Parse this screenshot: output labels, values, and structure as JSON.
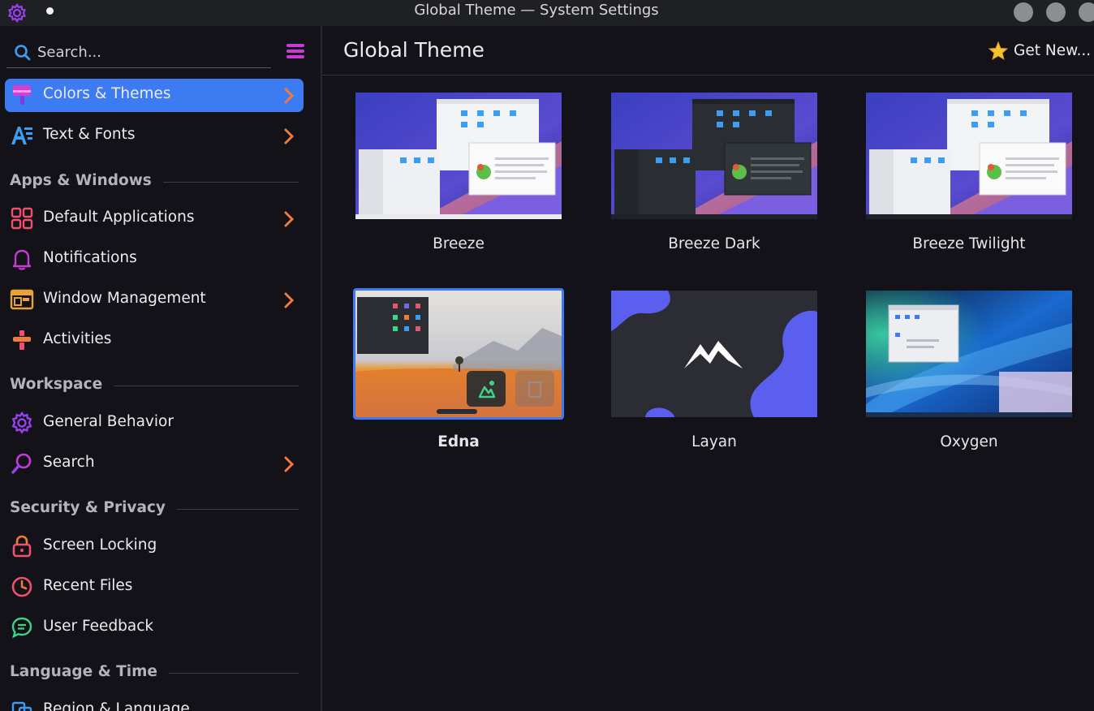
{
  "window": {
    "title": "Global Theme — System Settings"
  },
  "sidebar": {
    "search_placeholder": "Search...",
    "items": [
      {
        "label": "Colors & Themes",
        "active": true,
        "chevron": true
      },
      {
        "label": "Text & Fonts",
        "chevron": true
      },
      {
        "label": "Default Applications",
        "chevron": true
      },
      {
        "label": "Notifications",
        "chevron": false
      },
      {
        "label": "Window Management",
        "chevron": true
      },
      {
        "label": "Activities",
        "chevron": false
      },
      {
        "label": "General Behavior",
        "chevron": false
      },
      {
        "label": "Search",
        "chevron": true
      },
      {
        "label": "Screen Locking",
        "chevron": false
      },
      {
        "label": "Recent Files",
        "chevron": false
      },
      {
        "label": "User Feedback",
        "chevron": false
      },
      {
        "label": "Region & Language",
        "chevron": false
      }
    ],
    "sections": [
      {
        "label": "Apps & Windows"
      },
      {
        "label": "Workspace"
      },
      {
        "label": "Security & Privacy"
      },
      {
        "label": "Language & Time"
      }
    ]
  },
  "main": {
    "title": "Global Theme",
    "get_new_label": "Get New...",
    "themes": [
      {
        "name": "Breeze",
        "selected": false
      },
      {
        "name": "Breeze Dark",
        "selected": false
      },
      {
        "name": "Breeze Twilight",
        "selected": false
      },
      {
        "name": "Edna",
        "selected": true
      },
      {
        "name": "Layan",
        "selected": false
      },
      {
        "name": "Oxygen",
        "selected": false
      }
    ]
  },
  "colors": {
    "accent": "#3c7bf2",
    "background": "#121218",
    "titlebar": "#1f2024"
  },
  "icons": {
    "app": "gear-icon",
    "search": "search-icon",
    "menu": "hamburger-menu-icon",
    "get_new": "star-icon",
    "theme_apply": "apply-theme-icon",
    "theme_delete": "trash-icon"
  }
}
